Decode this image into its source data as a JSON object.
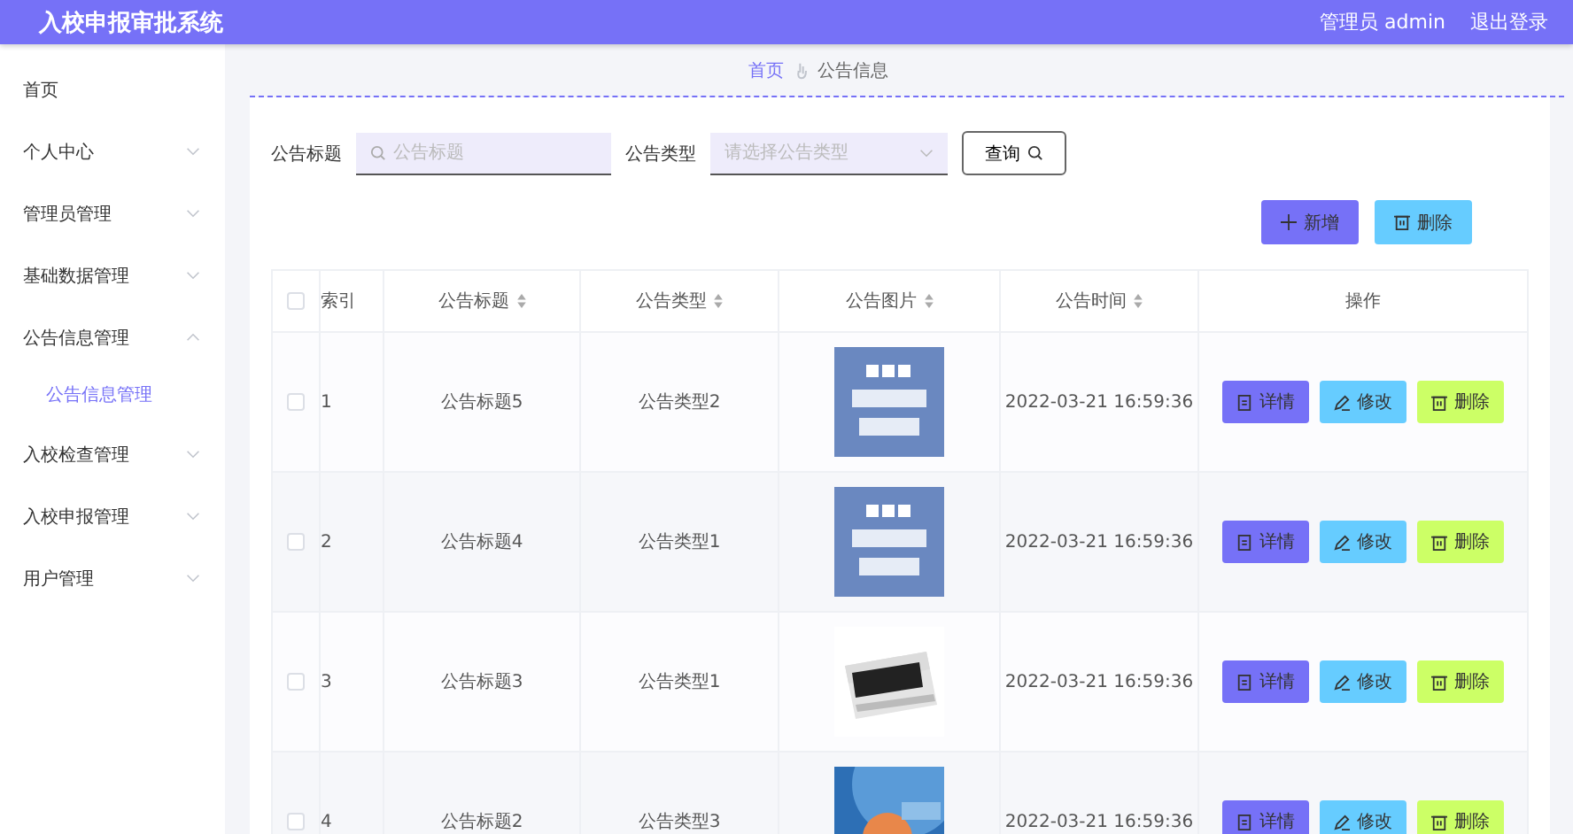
{
  "header": {
    "title": "入校申报审批系统",
    "user": "管理员 admin",
    "logout": "退出登录"
  },
  "sidebar": {
    "items": [
      {
        "label": "首页",
        "kind": "link"
      },
      {
        "label": "个人中心",
        "kind": "menu",
        "expanded": false
      },
      {
        "label": "管理员管理",
        "kind": "menu",
        "expanded": false
      },
      {
        "label": "基础数据管理",
        "kind": "menu",
        "expanded": false
      },
      {
        "label": "公告信息管理",
        "kind": "menu",
        "expanded": true,
        "children": [
          {
            "label": "公告信息管理",
            "selected": true
          }
        ]
      },
      {
        "label": "入校检查管理",
        "kind": "menu",
        "expanded": false
      },
      {
        "label": "入校申报管理",
        "kind": "menu",
        "expanded": false
      },
      {
        "label": "用户管理",
        "kind": "menu",
        "expanded": false
      }
    ]
  },
  "breadcrumb": [
    "首页",
    "公告信息"
  ],
  "search": {
    "title_label": "公告标题",
    "title_placeholder": "公告标题",
    "type_label": "公告类型",
    "type_placeholder": "请选择公告类型",
    "query_button": "查询"
  },
  "actions": {
    "add": "新增",
    "delete": "删除"
  },
  "table": {
    "header_checked": false,
    "columns": [
      {
        "label": "索引",
        "sortable": false
      },
      {
        "label": "公告标题",
        "sortable": true
      },
      {
        "label": "公告类型",
        "sortable": true
      },
      {
        "label": "公告图片",
        "sortable": true
      },
      {
        "label": "公告时间",
        "sortable": true
      },
      {
        "label": "操作",
        "sortable": false
      }
    ],
    "rows": [
      {
        "checked": false,
        "index": "1",
        "title": "公告标题5",
        "type": "公告类型2",
        "picture": {
          "kind": "picture"
        },
        "time": "2022-03-21 16:59:36",
        "buttons": [
          "详情",
          "修改",
          "删除"
        ]
      },
      {
        "checked": false,
        "index": "2",
        "title": "公告标题4",
        "type": "公告类型1",
        "picture": {
          "kind": "picture"
        },
        "time": "2022-03-21 16:59:36",
        "buttons": [
          "详情",
          "修改",
          "删除"
        ]
      },
      {
        "checked": false,
        "index": "3",
        "title": "公告标题3",
        "type": "公告类型1",
        "picture": {
          "kind": "picture"
        },
        "time": "2022-03-21 16:59:36",
        "buttons": [
          "详情",
          "修改",
          "删除"
        ]
      },
      {
        "checked": false,
        "index": "4",
        "title": "公告标题2",
        "type": "公告类型3",
        "picture": {
          "kind": "picture"
        },
        "time": "2022-03-21 16:59:36",
        "buttons": [
          "详情",
          "修改",
          "删除"
        ]
      }
    ]
  }
}
